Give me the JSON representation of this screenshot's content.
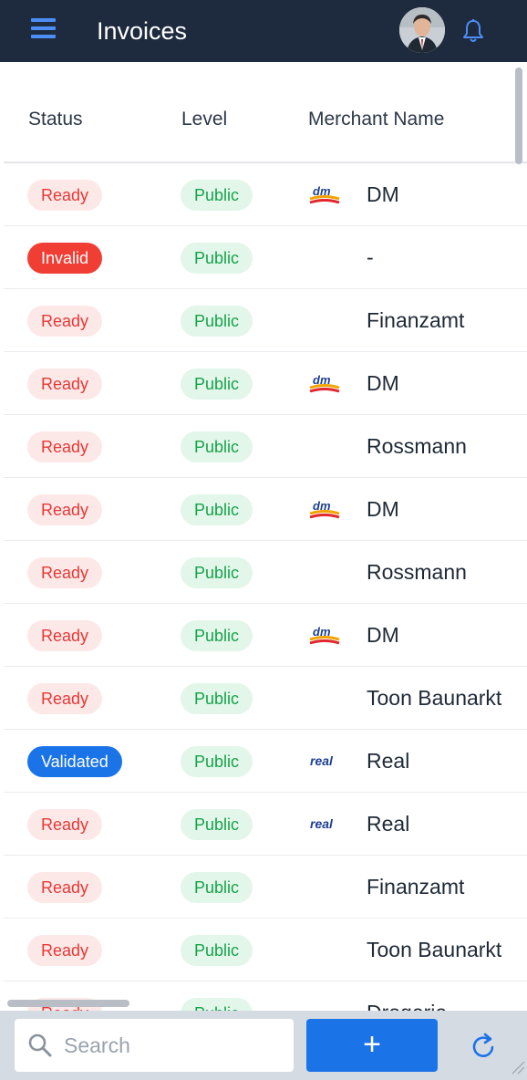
{
  "header": {
    "title": "Invoices",
    "menu_icon": "hamburger-menu-icon",
    "avatar": "user-avatar",
    "notification_icon": "bell-icon"
  },
  "table": {
    "columns": [
      "Status",
      "Level",
      "Merchant Name"
    ],
    "rows": [
      {
        "status": "Ready",
        "status_type": "ready",
        "level": "Public",
        "merchant": "DM",
        "logo": "dm-logo"
      },
      {
        "status": "Invalid",
        "status_type": "invalid",
        "level": "Public",
        "merchant": "-",
        "logo": ""
      },
      {
        "status": "Ready",
        "status_type": "ready",
        "level": "Public",
        "merchant": "Finanzamt",
        "logo": ""
      },
      {
        "status": "Ready",
        "status_type": "ready",
        "level": "Public",
        "merchant": "DM",
        "logo": "dm-logo"
      },
      {
        "status": "Ready",
        "status_type": "ready",
        "level": "Public",
        "merchant": "Rossmann",
        "logo": ""
      },
      {
        "status": "Ready",
        "status_type": "ready",
        "level": "Public",
        "merchant": "DM",
        "logo": "dm-logo"
      },
      {
        "status": "Ready",
        "status_type": "ready",
        "level": "Public",
        "merchant": "Rossmann",
        "logo": ""
      },
      {
        "status": "Ready",
        "status_type": "ready",
        "level": "Public",
        "merchant": "DM",
        "logo": "dm-logo"
      },
      {
        "status": "Ready",
        "status_type": "ready",
        "level": "Public",
        "merchant": "Toon Baunarkt",
        "logo": ""
      },
      {
        "status": "Validated",
        "status_type": "validated",
        "level": "Public",
        "merchant": "Real",
        "logo": "real-logo"
      },
      {
        "status": "Ready",
        "status_type": "ready",
        "level": "Public",
        "merchant": "Real",
        "logo": "real-logo"
      },
      {
        "status": "Ready",
        "status_type": "ready",
        "level": "Public",
        "merchant": "Finanzamt",
        "logo": ""
      },
      {
        "status": "Ready",
        "status_type": "ready",
        "level": "Public",
        "merchant": "Toon Baunarkt",
        "logo": ""
      },
      {
        "status": "Ready",
        "status_type": "ready",
        "level": "Public",
        "merchant": "Drogerie",
        "logo": ""
      }
    ]
  },
  "footer": {
    "search_placeholder": "Search",
    "search_value": "",
    "add_label": "+",
    "refresh_icon": "refresh-icon"
  },
  "colors": {
    "topbar": "#1e2b3e",
    "accent": "#1b73e8",
    "ready_bg": "#fde8e8",
    "ready_text": "#e53935",
    "invalid": "#f03e35",
    "public_bg": "#e3f6ea",
    "public_text": "#16a34a"
  }
}
